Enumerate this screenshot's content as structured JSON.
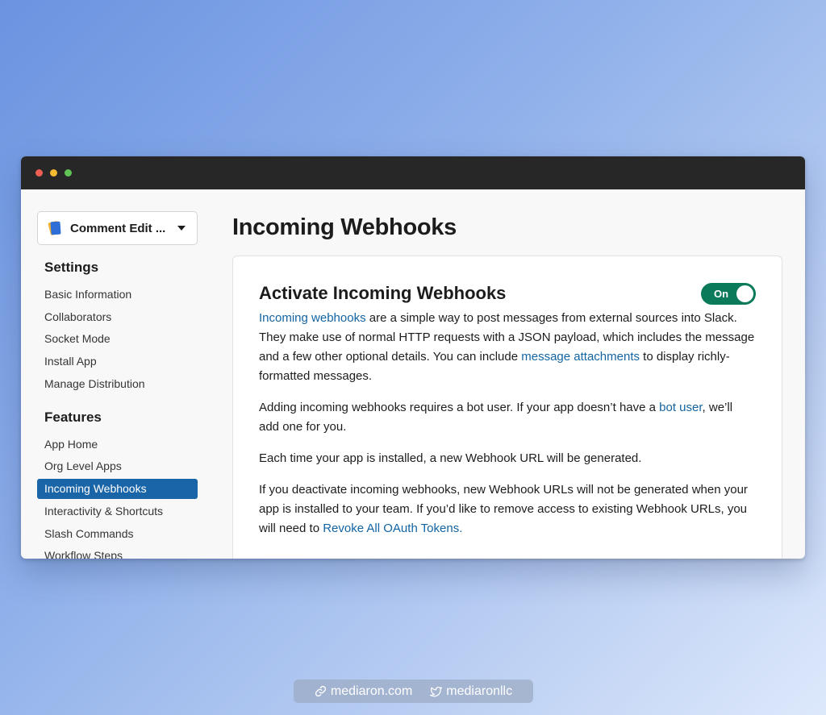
{
  "window": {
    "controls": [
      "close",
      "minimize",
      "maximize"
    ]
  },
  "sidebar": {
    "app_name": "Comment Edit ...",
    "settings_title": "Settings",
    "settings_items": [
      "Basic Information",
      "Collaborators",
      "Socket Mode",
      "Install App",
      "Manage Distribution"
    ],
    "features_title": "Features",
    "features_items": [
      "App Home",
      "Org Level Apps",
      "Incoming Webhooks",
      "Interactivity & Shortcuts",
      "Slash Commands",
      "Workflow Steps"
    ],
    "active_item": "Incoming Webhooks"
  },
  "main": {
    "page_title": "Incoming Webhooks",
    "card": {
      "title": "Activate Incoming Webhooks",
      "toggle_label": "On",
      "p1": {
        "link1": "Incoming webhooks",
        "text1": " are a simple way to post messages from external sources into Slack. They make use of normal HTTP requests with a JSON payload, which includes the message and a few other optional details. You can include ",
        "link2": "message attachments",
        "text2": " to display richly-formatted messages."
      },
      "p2": {
        "text1": "Adding incoming webhooks requires a bot user. If your app doesn’t have a ",
        "link": "bot user",
        "text2": ", we’ll add one for you."
      },
      "p3": "Each time your app is installed, a new Webhook URL will be generated.",
      "p4": {
        "text1": "If you deactivate incoming webhooks, new Webhook URLs will not be generated when your app is installed to your team. If you’d like to remove access to existing Webhook URLs, you will need to ",
        "link": "Revoke All OAuth Tokens."
      }
    }
  },
  "footer": {
    "website": "mediaron.com",
    "twitter": "mediaronllc"
  },
  "colors": {
    "active_nav": "#1a64a8",
    "link": "#1264a3",
    "toggle": "#0a7a5a",
    "titlebar": "#272727"
  }
}
